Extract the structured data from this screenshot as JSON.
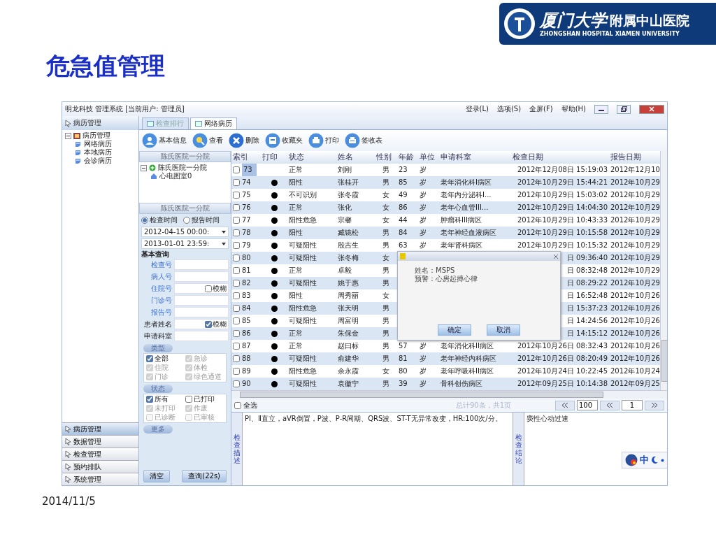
{
  "slide": {
    "title": "危急值管理",
    "date": "2014/11/5",
    "logo": {
      "name_cn": "厦门大学",
      "affiliate": "附属中山医院",
      "name_en": "ZHONGSHAN HOSPITAL XIAMEN UNIVERSITY"
    }
  },
  "window": {
    "title": "明龙科技 管理系统 [当前用户: 管理员]",
    "menu": [
      "登录(L)",
      "选项(S)",
      "全屏(F)",
      "帮助(H)"
    ]
  },
  "sidebar": {
    "header": "病历管理",
    "tree": [
      {
        "label": "病历管理",
        "expanded": true,
        "children": [
          {
            "label": "网络病历"
          },
          {
            "label": "本地病历"
          },
          {
            "label": "会诊病历"
          }
        ]
      }
    ],
    "nav": [
      {
        "label": "病历管理",
        "selected": true
      },
      {
        "label": "数据管理",
        "selected": false
      },
      {
        "label": "检查管理",
        "selected": false
      },
      {
        "label": "预约排队",
        "selected": false
      },
      {
        "label": "系统管理",
        "selected": false
      }
    ]
  },
  "tabs": [
    {
      "label": "检查排行",
      "selected": false
    },
    {
      "label": "网络病历",
      "selected": true
    }
  ],
  "toolbar": [
    "基本信息",
    "查看",
    "删除",
    "收藏夹",
    "打印",
    "签收表"
  ],
  "filter_panel": {
    "tree_header": "陈氏医院一分院",
    "tree": [
      {
        "label": "陈氏医院一分院",
        "expanded": true,
        "children": [
          {
            "label": "心电图室0"
          }
        ]
      }
    ],
    "header": "陈氏医院一分院",
    "time_mode": [
      {
        "label": "检查时间",
        "selected": true
      },
      {
        "label": "报告时间",
        "selected": false
      }
    ],
    "date_from": "2012-04-15 00:00:",
    "date_to": "2013-01-01 23:59:",
    "query_title": "基本查询",
    "fields": [
      {
        "label": "检查号",
        "kind": "number"
      },
      {
        "label": "病人号",
        "kind": "number"
      },
      {
        "label": "住院号",
        "kind": "number",
        "fuzzy": {
          "label": "模糊",
          "checked": false
        }
      },
      {
        "label": "门诊号",
        "kind": "number"
      },
      {
        "label": "报告号",
        "kind": "number"
      },
      {
        "label": "患者姓名",
        "kind": "text",
        "fuzzy": {
          "label": "模糊",
          "checked": true
        }
      },
      {
        "label": "申请科室",
        "kind": "text"
      }
    ],
    "groups": [
      {
        "title": "类型",
        "options": [
          {
            "label": "全部",
            "checked": true,
            "disabled": false
          },
          {
            "label": "急诊",
            "checked": true,
            "disabled": true
          },
          {
            "label": "住院",
            "checked": true,
            "disabled": true
          },
          {
            "label": "体检",
            "checked": true,
            "disabled": true
          },
          {
            "label": "门诊",
            "checked": true,
            "disabled": true
          },
          {
            "label": "绿色通道",
            "checked": true,
            "disabled": true
          }
        ]
      },
      {
        "title": "状态",
        "options": [
          {
            "label": "所有",
            "checked": true,
            "disabled": false
          },
          {
            "label": "已打印",
            "checked": false,
            "disabled": false
          },
          {
            "label": "未打印",
            "checked": true,
            "disabled": true
          },
          {
            "label": "作废",
            "checked": true,
            "disabled": true
          },
          {
            "label": "已诊断",
            "checked": false,
            "disabled": true
          },
          {
            "label": "已审核",
            "checked": false,
            "disabled": true
          }
        ]
      },
      {
        "title": "更多"
      }
    ],
    "buttons": [
      "清空",
      "查询(22s)"
    ]
  },
  "table": {
    "columns": [
      "索引",
      "打印",
      "状态",
      "姓名",
      "性别",
      "年龄",
      "单位",
      "申请科室",
      "检查日期",
      "报告日期"
    ],
    "rows": [
      {
        "index": "73",
        "checked": false,
        "selected": true,
        "printed": false,
        "status": "正常",
        "name": "刘刚",
        "sex": "男",
        "age": "23",
        "unit": "岁",
        "dept": "",
        "check_date": "2012年12月08日 15:19:03",
        "report_date": "2012年12月10"
      },
      {
        "index": "74",
        "checked": false,
        "selected": false,
        "printed": true,
        "status": "阳性",
        "name": "张桂开",
        "sex": "男",
        "age": "85",
        "unit": "岁",
        "dept": "老年消化科I病区",
        "check_date": "2012年10月29日 15:44:21",
        "report_date": "2012年10月29"
      },
      {
        "index": "75",
        "checked": false,
        "selected": false,
        "printed": true,
        "status": "不可识别",
        "name": "张冬霞",
        "sex": "女",
        "age": "49",
        "unit": "岁",
        "dept": "老年内分泌科I...",
        "check_date": "2012年10月29日 15:03:02",
        "report_date": "2012年10月29"
      },
      {
        "index": "76",
        "checked": false,
        "selected": false,
        "printed": true,
        "status": "正常",
        "name": "张化",
        "sex": "女",
        "age": "86",
        "unit": "岁",
        "dept": "老年心血管III...",
        "check_date": "2012年10月29日 14:04:30",
        "report_date": "2012年10月29"
      },
      {
        "index": "77",
        "checked": false,
        "selected": false,
        "printed": true,
        "status": "阳性危急",
        "name": "宗馨",
        "sex": "女",
        "age": "44",
        "unit": "岁",
        "dept": "肿瘤科III病区",
        "check_date": "2012年10月29日 10:43:33",
        "report_date": "2012年10月29"
      },
      {
        "index": "78",
        "checked": false,
        "selected": false,
        "printed": true,
        "status": "阳性",
        "name": "臧镜松",
        "sex": "男",
        "age": "84",
        "unit": "岁",
        "dept": "老年神经血液病区",
        "check_date": "2012年10月29日 10:15:58",
        "report_date": "2012年10月29"
      },
      {
        "index": "79",
        "checked": false,
        "selected": false,
        "printed": true,
        "status": "可疑阳性",
        "name": "殷吉生",
        "sex": "男",
        "age": "63",
        "unit": "岁",
        "dept": "老年肾科病区",
        "check_date": "2012年10月29日 10:15:32",
        "report_date": "2012年10月29"
      },
      {
        "index": "80",
        "checked": false,
        "selected": false,
        "printed": true,
        "status": "可疑阳性",
        "name": "张冬梅",
        "sex": "女",
        "check_date": "日 09:36:40",
        "report_date": "2012年10月29"
      },
      {
        "index": "81",
        "checked": false,
        "selected": false,
        "printed": true,
        "status": "正常",
        "name": "卓毅",
        "sex": "男",
        "check_date": "日 08:32:48",
        "report_date": "2012年10月29"
      },
      {
        "index": "82",
        "checked": false,
        "selected": false,
        "printed": true,
        "status": "可疑阳性",
        "name": "姚于惠",
        "sex": "男",
        "check_date": "日 08:29:22",
        "report_date": "2012年10月29"
      },
      {
        "index": "83",
        "checked": false,
        "selected": false,
        "printed": true,
        "status": "阳性",
        "name": "周秀丽",
        "sex": "女",
        "check_date": "日 16:52:48",
        "report_date": "2012年10月26"
      },
      {
        "index": "84",
        "checked": false,
        "selected": false,
        "printed": true,
        "status": "阳性危急",
        "name": "张天明",
        "sex": "男",
        "check_date": "日 15:37:23",
        "report_date": "2012年10月26"
      },
      {
        "index": "85",
        "checked": false,
        "selected": false,
        "printed": true,
        "status": "可疑阳性",
        "name": "周富明",
        "sex": "男",
        "check_date": "日 14:24:56",
        "report_date": "2012年10月26"
      },
      {
        "index": "86",
        "checked": false,
        "selected": false,
        "printed": true,
        "status": "正常",
        "name": "朱保金",
        "sex": "男",
        "check_date": "日 14:15:12",
        "report_date": "2012年10月26"
      },
      {
        "index": "87",
        "checked": false,
        "selected": false,
        "printed": true,
        "status": "正常",
        "name": "赵曰标",
        "sex": "男",
        "age": "57",
        "unit": "岁",
        "dept": "老年消化科II病区",
        "check_date": "2012年10月26日 08:32:43",
        "report_date": "2012年10月26"
      },
      {
        "index": "88",
        "checked": false,
        "selected": false,
        "printed": true,
        "status": "可疑阳性",
        "name": "俞建华",
        "sex": "男",
        "age": "81",
        "unit": "岁",
        "dept": "老年神经内科病区",
        "check_date": "2012年10月26日 08:20:49",
        "report_date": "2012年10月26"
      },
      {
        "index": "89",
        "checked": false,
        "selected": false,
        "printed": true,
        "status": "阳性危急",
        "name": "余永霞",
        "sex": "女",
        "age": "80",
        "unit": "岁",
        "dept": "老年呼吸科II病区",
        "check_date": "2012年10月24日 10:22:45",
        "report_date": "2012年10月24"
      },
      {
        "index": "90",
        "checked": false,
        "selected": false,
        "printed": true,
        "status": "可疑阳性",
        "name": "袁徽宁",
        "sex": "男",
        "age": "39",
        "unit": "岁",
        "dept": "骨科创伤病区",
        "check_date": "2012年09月25日 10:14:38",
        "report_date": "2012年09月25"
      }
    ]
  },
  "dialog": {
    "lines": [
      "姓名：MSPS",
      "预警：心房起搏心律"
    ],
    "buttons": [
      "确定",
      "取消"
    ]
  },
  "footer": {
    "select_all": {
      "label": "全选",
      "checked": false
    },
    "summary": "总计90条，共1页",
    "page_size": "100",
    "page": "1"
  },
  "detail": {
    "description_label": "检查描述",
    "description": "PⅠ、Ⅱ直立，aVR倒置，P波、P-R间期、QRS波、ST-T无异常改变，HR:100次/分。",
    "conclusion_label": "检查结论",
    "conclusion": "窦性心动过速"
  },
  "ime": {
    "label": "中"
  }
}
